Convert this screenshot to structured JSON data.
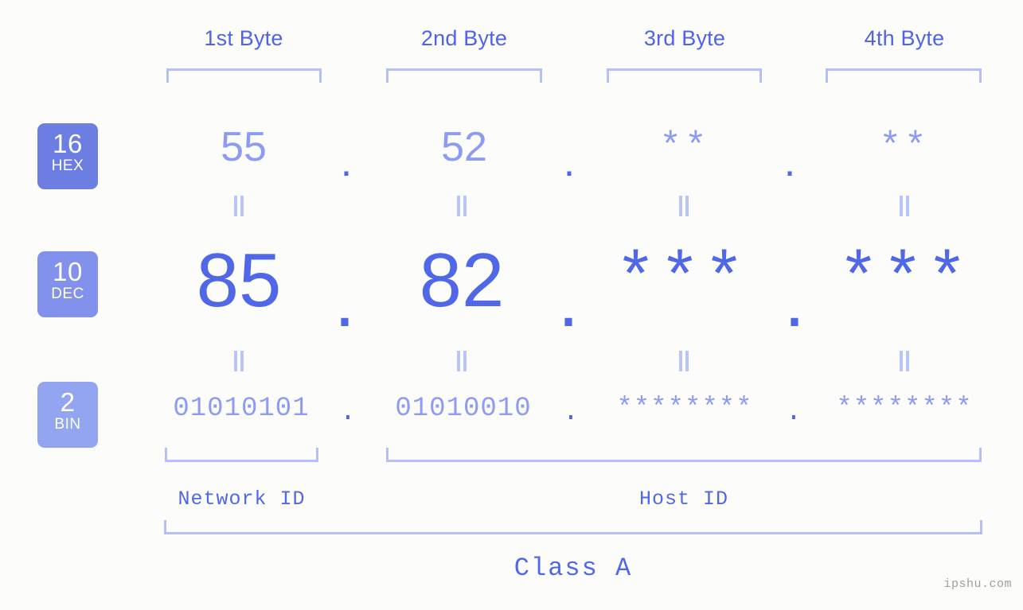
{
  "page": {
    "background_color": "#fcfdfa",
    "accent_color": "#5068e8",
    "accent_light_color": "#8d9cf2",
    "bracket_color": "#b4c0f7",
    "watermark": "ipshu.com"
  },
  "headers": {
    "byte1": "1st Byte",
    "byte2": "2nd Byte",
    "byte3": "3rd Byte",
    "byte4": "4th Byte"
  },
  "bases": [
    {
      "number": "16",
      "name": "HEX",
      "color": "#6d7ee2"
    },
    {
      "number": "10",
      "name": "DEC",
      "color": "#8291ec"
    },
    {
      "number": "2",
      "name": "BIN",
      "color": "#93a5f1"
    }
  ],
  "rows": {
    "hex": {
      "values": [
        "55",
        "52",
        "**",
        "**"
      ],
      "separator": "."
    },
    "dec": {
      "values": [
        "85",
        "82",
        "***",
        "***"
      ],
      "separator": "."
    },
    "bin": {
      "values": [
        "01010101",
        "01010010",
        "********",
        "********"
      ],
      "separator": "."
    }
  },
  "equals_symbol": "=",
  "segments": {
    "network_id": "Network ID",
    "host_id": "Host ID",
    "class": "Class A"
  }
}
